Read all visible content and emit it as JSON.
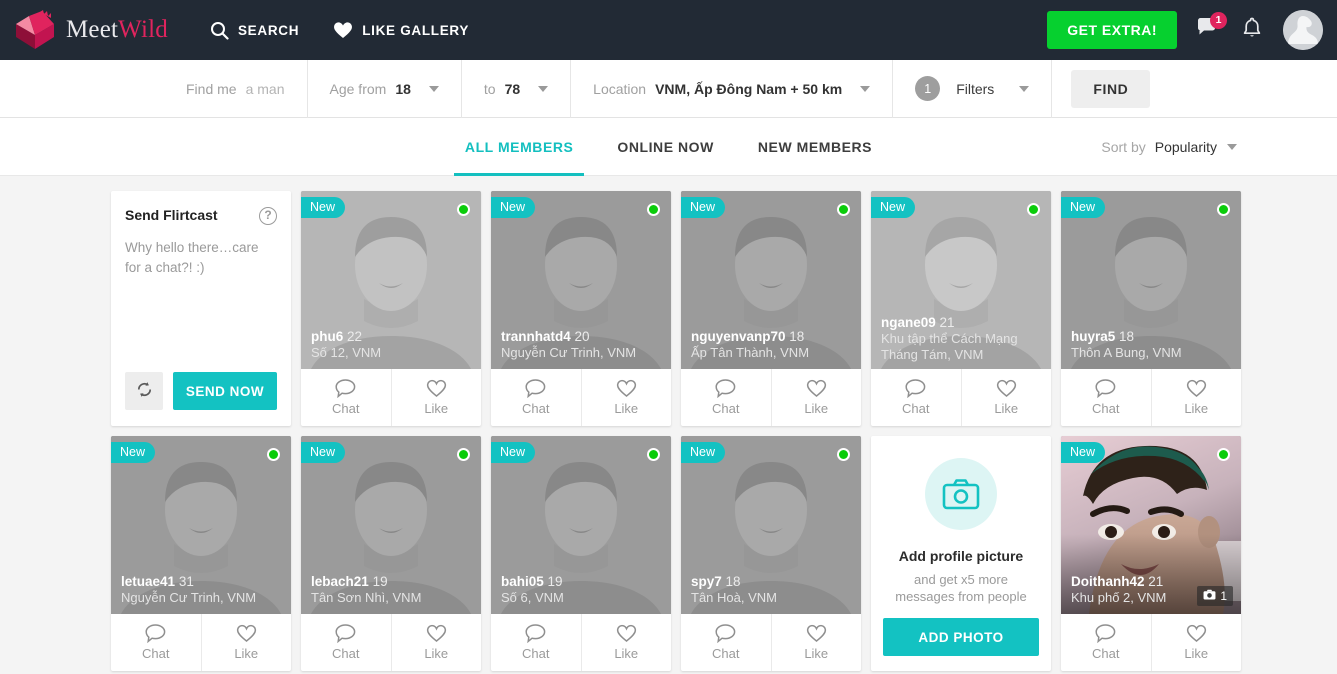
{
  "header": {
    "logo_text_a": "Meet",
    "logo_text_b": "Wild",
    "logo_icon": "heart-logo-icon",
    "nav": [
      {
        "label": "SEARCH",
        "icon": "search-icon"
      },
      {
        "label": "LIKE GALLERY",
        "icon": "heart-icon"
      }
    ],
    "get_extra_label": "GET EXTRA!",
    "messages_badge": "1",
    "messages_icon": "chat-bubble-icon",
    "notifications_icon": "bell-icon",
    "avatar_icon": "user-avatar-icon"
  },
  "search": {
    "find_me_label": "Find me",
    "find_me_value": "a man",
    "age_from_label": "Age from",
    "age_from_value": "18",
    "age_to_label": "to",
    "age_to_value": "78",
    "location_label": "Location",
    "location_value": "VNM, Ấp Đông Nam + 50 km",
    "filters_count": "1",
    "filters_label": "Filters",
    "find_label": "FIND"
  },
  "tabs": [
    {
      "label": "ALL MEMBERS",
      "active": true
    },
    {
      "label": "ONLINE NOW",
      "active": false
    },
    {
      "label": "NEW MEMBERS",
      "active": false
    }
  ],
  "sort": {
    "label": "Sort by",
    "value": "Popularity"
  },
  "flirtcast": {
    "title": "Send Flirtcast",
    "help_icon": "question-mark-icon",
    "message": "Why hello there…care for a chat?! :)",
    "refresh_icon": "refresh-icon",
    "send_label": "SEND NOW"
  },
  "card_actions": {
    "chat_label": "Chat",
    "like_label": "Like",
    "chat_icon": "chat-bubble-icon",
    "like_icon": "heart-outline-icon"
  },
  "add_photo_card": {
    "icon": "camera-icon",
    "title": "Add profile picture",
    "subtitle": "and get x5 more messages from people",
    "button_label": "ADD PHOTO"
  },
  "profiles": [
    {
      "name": "phu6",
      "age": "22",
      "location": "Số 12, VNM",
      "new": "New",
      "online": true,
      "tone": "light",
      "photos": ""
    },
    {
      "name": "trannhatd4",
      "age": "20",
      "location": "Nguyễn Cư Trinh, VNM",
      "new": "New",
      "online": true,
      "tone": "dark",
      "photos": ""
    },
    {
      "name": "nguyenvanp70",
      "age": "18",
      "location": "Ấp Tân Thành, VNM",
      "new": "New",
      "online": true,
      "tone": "dark",
      "photos": ""
    },
    {
      "name": "ngane09",
      "age": "21",
      "location": "Khu tập thể Cách Mạng Tháng Tám, VNM",
      "new": "New",
      "online": true,
      "tone": "light",
      "photos": ""
    },
    {
      "name": "huyra5",
      "age": "18",
      "location": "Thôn A Bung, VNM",
      "new": "New",
      "online": true,
      "tone": "dark",
      "photos": ""
    },
    {
      "name": "letuae41",
      "age": "31",
      "location": "Nguyễn Cư Trinh, VNM",
      "new": "New",
      "online": true,
      "tone": "dark",
      "photos": ""
    },
    {
      "name": "lebach21",
      "age": "19",
      "location": "Tân Sơn Nhì, VNM",
      "new": "New",
      "online": true,
      "tone": "dark",
      "photos": ""
    },
    {
      "name": "bahi05",
      "age": "19",
      "location": "Số 6, VNM",
      "new": "New",
      "online": true,
      "tone": "dark",
      "photos": ""
    },
    {
      "name": "spy7",
      "age": "18",
      "location": "Tân Hoà, VNM",
      "new": "New",
      "online": true,
      "tone": "dark",
      "photos": ""
    },
    {
      "name": "Doithanh42",
      "age": "21",
      "location": "Khu phố 2, VNM",
      "new": "New",
      "online": true,
      "tone": "photo",
      "photos": "1"
    }
  ],
  "colors": {
    "accent_teal": "#13c2c2",
    "brand_pink": "#e0245e",
    "green": "#06d02f",
    "header_bg": "#222a35",
    "online_dot": "#0bcc0b"
  }
}
